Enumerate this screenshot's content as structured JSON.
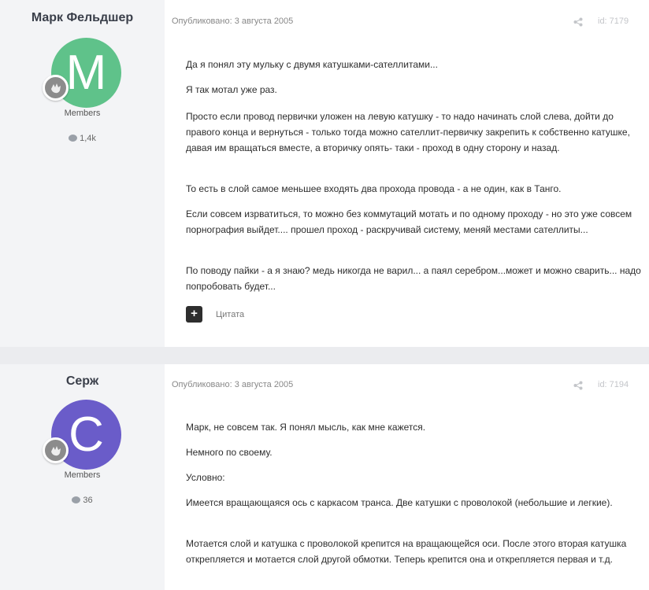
{
  "posts": [
    {
      "author": "Марк Фельдшер",
      "avatar_letter": "M",
      "avatar_color": "#5fc28a",
      "group": "Members",
      "post_count": "1,4k",
      "published": "Опубликовано: 3 августа 2005",
      "id": "id: 7179",
      "paragraphs": [
        "Да я понял эту мульку с двумя катушками-сателлитами...",
        "Я так мотал уже раз.",
        "Просто если провод первички уложен на левую катушку - то надо начинать слой слева, дойти до правого конца и вернуться - только тогда можно сателлит-первичку закрепить к собственно катушке, давая им вращаться вместе, а вторичку опять- таки - проход в одну сторону и назад.",
        "То есть в слой самое меньшее входять два прохода провода - а не один, как в Танго.",
        "Если совсем изрватиться, то можно без коммутаций мотать и по одному проходу - но это уже совсем порнография выйдет.... прошел проход - раскручивай систему, меняй местами сателлиты...",
        "По поводу пайки - а я знаю? медь никогда не варил... а паял серебром...может и можно сварить... надо попробовать будет..."
      ],
      "plus_label": "+",
      "quote_label": "Цитата"
    },
    {
      "author": "Серж",
      "avatar_letter": "C",
      "avatar_color": "#6a5cc9",
      "group": "Members",
      "post_count": "36",
      "published": "Опубликовано: 3 августа 2005",
      "id": "id: 7194",
      "paragraphs": [
        "Марк, не совсем так. Я понял мысль, как мне кажется.",
        "Немного по своему.",
        "Условно:",
        "Имеется вращающаяся ось с каркасом транса. Две катушки с проволокой (небольшие и легкие).",
        "Мотается слой и катушка с проволокой крепится на вращающейся оси. После этого вторая катушка открепляется и мотается слой другой обмотки. Теперь крепится она и открепляется первая и т.д."
      ]
    }
  ]
}
